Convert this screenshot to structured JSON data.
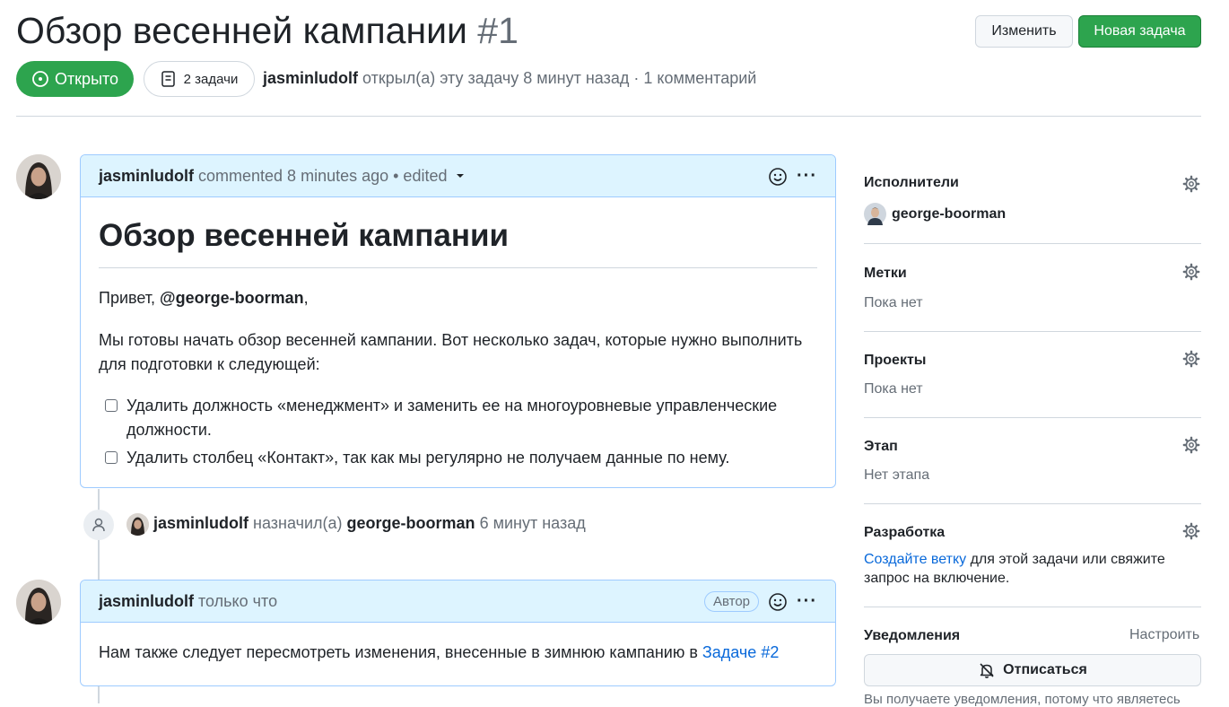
{
  "header": {
    "title": "Обзор весенней кампании",
    "number": "#1",
    "edit_label": "Изменить",
    "new_issue_label": "Новая задача",
    "state_label": "Открыто",
    "tasks_label": "2 задачи",
    "author": "jasminludolf",
    "meta_text": "открыл(а) эту задачу 8 минут назад · 1 комментарий"
  },
  "comment1": {
    "author": "jasminludolf",
    "meta": "commented 8 minutes ago • edited",
    "heading": "Обзор весенней кампании",
    "greeting_prefix": "Привет, ",
    "mention": "@george-boorman",
    "greeting_suffix": ",",
    "paragraph": "Мы готовы начать обзор весенней кампании. Вот несколько задач, которые нужно выполнить для подготовки к следующей:",
    "tasks": [
      {
        "text": "Удалить должность «менеджмент» и заменить ее на многоуровневые управленческие должности.",
        "checked": false
      },
      {
        "text": "Удалить столбец «Контакт», так как мы регулярно не получаем данные по нему.",
        "checked": false
      }
    ]
  },
  "event": {
    "actor": "jasminludolf",
    "action": "назначил(а)",
    "target": "george-boorman",
    "time": "6 минут назад"
  },
  "comment2": {
    "author": "jasminludolf",
    "meta": "только что",
    "badge": "Автор",
    "text": "Нам также следует пересмотреть изменения, внесенные в зимнюю кампанию в ",
    "link": "Задаче #2"
  },
  "sidebar": {
    "assignees_label": "Исполнители",
    "assignee": "george-boorman",
    "labels_label": "Метки",
    "labels_value": "Пока нет",
    "projects_label": "Проекты",
    "projects_value": "Пока нет",
    "milestone_label": "Этап",
    "milestone_value": "Нет этапа",
    "development_label": "Разработка",
    "development_link": "Создайте ветку",
    "development_text": " для этой задачи или свяжите запрос на включение.",
    "notifications_label": "Уведомления",
    "notifications_customize": "Настроить",
    "unsubscribe_label": "Отписаться",
    "notifications_note": "Вы получаете уведомления, потому что являетесь"
  },
  "colors": {
    "primary": "#2da44e",
    "link": "#0969da",
    "comment_header": "#ddf4ff",
    "comment_border": "#9ecbff"
  },
  "icons": [
    "issue-opened-icon",
    "tasklist-icon",
    "smiley-icon",
    "kebab-icon",
    "person-icon",
    "gear-icon",
    "bell-slash-icon",
    "caret-down-icon"
  ]
}
